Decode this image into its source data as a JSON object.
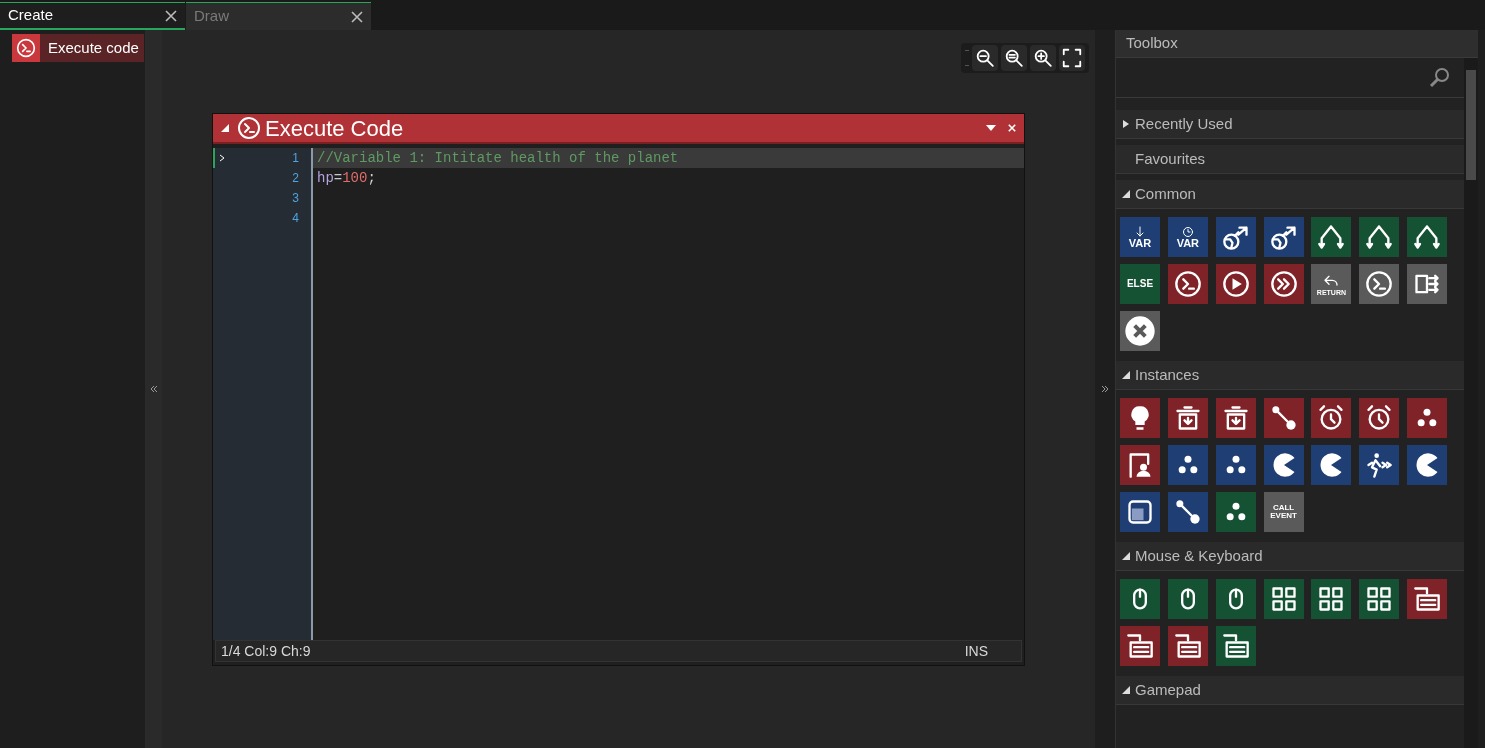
{
  "tabs": [
    {
      "label": "Create",
      "selected": true
    },
    {
      "label": "Draw",
      "selected": false
    }
  ],
  "events": [
    {
      "label": "Execute code",
      "selected": true
    }
  ],
  "code_window": {
    "title": "Execute Code",
    "lines": [
      {
        "number": "1",
        "current": true,
        "segments": [
          {
            "kind": "comment",
            "text": "//Variable 1: Intitate health of the planet"
          }
        ]
      },
      {
        "number": "2",
        "current": false,
        "segments": [
          {
            "kind": "identifier",
            "text": "hp"
          },
          {
            "kind": "operator",
            "text": "="
          },
          {
            "kind": "number",
            "text": "100"
          },
          {
            "kind": "punct",
            "text": ";"
          }
        ]
      },
      {
        "number": "3",
        "current": false
      },
      {
        "number": "4",
        "current": false
      }
    ],
    "status": {
      "position": "1/4 Col:9 Ch:9",
      "mode": "INS"
    }
  },
  "toolbox": {
    "title": "Toolbox",
    "sections": [
      {
        "label": "Recently Used",
        "expanded": false
      },
      {
        "label": "Favourites"
      },
      {
        "label": "Common",
        "expanded": true,
        "tiles": [
          {
            "kind": "var-set",
            "text": "VAR",
            "color": "#1f3f74"
          },
          {
            "kind": "var-get",
            "text": "VAR",
            "color": "#1f3f74"
          },
          {
            "kind": "globe",
            "color": "#1f3f74"
          },
          {
            "kind": "globe",
            "color": "#1f3f74"
          },
          {
            "kind": "branch",
            "color": "#155234"
          },
          {
            "kind": "branch",
            "color": "#155234"
          },
          {
            "kind": "branch",
            "color": "#155234"
          },
          {
            "kind": "label",
            "text": "ELSE",
            "color": "#155234"
          },
          {
            "kind": "console",
            "color": "#7f2328"
          },
          {
            "kind": "play",
            "color": "#7f2328"
          },
          {
            "kind": "forward",
            "color": "#7f2328"
          },
          {
            "kind": "return",
            "text": "RETURN",
            "color": "#5a5a5a"
          },
          {
            "kind": "console",
            "color": "#5a5a5a"
          },
          {
            "kind": "shuffle",
            "color": "#5a5a5a"
          },
          {
            "kind": "close",
            "color": "#5a5a5a"
          }
        ]
      },
      {
        "label": "Instances",
        "expanded": true,
        "tiles": [
          {
            "kind": "bulb",
            "color": "#7f2328"
          },
          {
            "kind": "trash",
            "color": "#7f2328"
          },
          {
            "kind": "trash",
            "color": "#7f2328"
          },
          {
            "kind": "nodes",
            "color": "#7f2328"
          },
          {
            "kind": "clock",
            "color": "#7f2328"
          },
          {
            "kind": "clock",
            "color": "#7f2328"
          },
          {
            "kind": "dots",
            "color": "#7f2328"
          },
          {
            "kind": "flag",
            "color": "#7f2328"
          },
          {
            "kind": "dots",
            "color": "#1f3f74"
          },
          {
            "kind": "dots",
            "color": "#1f3f74"
          },
          {
            "kind": "pacman",
            "color": "#1f3f74"
          },
          {
            "kind": "pacman",
            "color": "#1f3f74"
          },
          {
            "kind": "runner",
            "color": "#1f3f74"
          },
          {
            "kind": "pacman",
            "color": "#1f3f74"
          },
          {
            "kind": "square",
            "color": "#1f3f74"
          },
          {
            "kind": "nodes",
            "color": "#1f3f74"
          },
          {
            "kind": "dots",
            "color": "#155234"
          },
          {
            "kind": "label",
            "text": "CALL EVENT",
            "color": "#5a5a5a"
          }
        ]
      },
      {
        "label": "Mouse & Keyboard",
        "expanded": true,
        "tiles": [
          {
            "kind": "mouse",
            "color": "#155234"
          },
          {
            "kind": "mouse",
            "color": "#155234"
          },
          {
            "kind": "mouse",
            "color": "#155234"
          },
          {
            "kind": "grid",
            "color": "#155234"
          },
          {
            "kind": "grid",
            "color": "#155234"
          },
          {
            "kind": "grid",
            "color": "#155234"
          },
          {
            "kind": "keyboard",
            "color": "#7f2328"
          },
          {
            "kind": "keyboard",
            "color": "#7f2328"
          },
          {
            "kind": "keyboard",
            "color": "#7f2328"
          },
          {
            "kind": "keyboard",
            "color": "#155234"
          }
        ]
      },
      {
        "label": "Gamepad",
        "expanded": true
      }
    ]
  }
}
